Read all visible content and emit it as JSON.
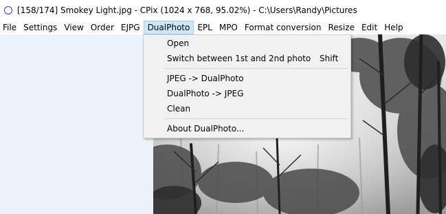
{
  "window": {
    "title": "[158/174] Smokey Light.jpg - CPix (1024 x 768, 95.02%) - C:\\Users\\Randy\\Pictures"
  },
  "menubar": {
    "items": [
      {
        "label": "File"
      },
      {
        "label": "Settings"
      },
      {
        "label": "View"
      },
      {
        "label": "Order"
      },
      {
        "label": "EJPG"
      },
      {
        "label": "DualPhoto",
        "active": true
      },
      {
        "label": "EPL"
      },
      {
        "label": "MPO"
      },
      {
        "label": "Format conversion"
      },
      {
        "label": "Resize"
      },
      {
        "label": "Edit"
      },
      {
        "label": "Help"
      }
    ]
  },
  "dropdown": {
    "items": [
      {
        "label": "Open"
      },
      {
        "label": "Switch between 1st and 2nd photo",
        "shortcut": "Shift"
      },
      {
        "label": "JPEG -> DualPhoto"
      },
      {
        "label": "DualPhoto -> JPEG"
      },
      {
        "label": "Clean"
      },
      {
        "label": "About DualPhoto..."
      }
    ]
  },
  "colors": {
    "menu_highlight": "#cce8ff",
    "menu_highlight_border": "#99d1ff",
    "dropdown_bg": "#f2f2f2",
    "workspace_bg": "#e8f4fa",
    "app_icon": "#2b3ad6"
  },
  "icons": {
    "app": "ring-icon"
  }
}
